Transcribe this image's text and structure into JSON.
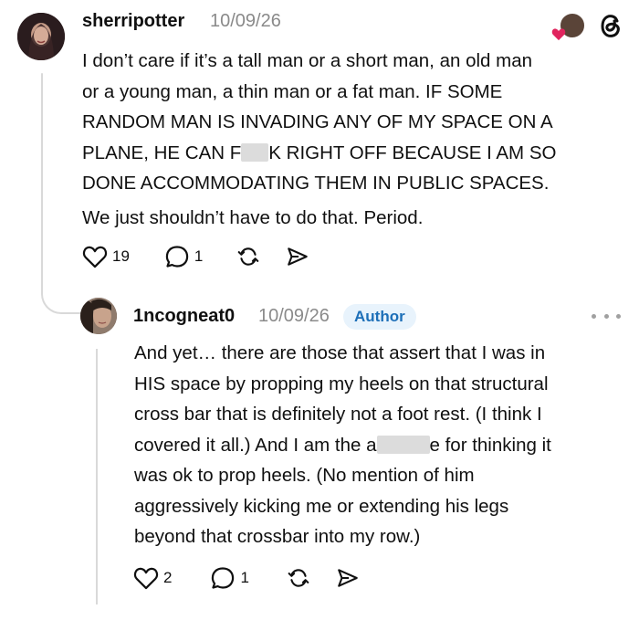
{
  "post": {
    "username": "sherripotter",
    "date": "10/09/26",
    "lines": [
      "I don’t care if it’s a tall man or a short man, an old man",
      "or a young man, a thin man or a fat man. IF SOME",
      "RANDOM MAN IS INVADING ANY OF MY SPACE ON A"
    ],
    "line4_before": "PLANE, HE CAN F",
    "line4_after": "K RIGHT OFF BECAUSE I AM SO",
    "lines_end": [
      "DONE ACCOMMODATING THEM IN PUBLIC SPACES.",
      "We just shouldn’t have to do that. Period."
    ],
    "likes": "19",
    "replies": "1"
  },
  "reply": {
    "username": "1ncogneat0",
    "date": "10/09/26",
    "badge": "Author",
    "lines": [
      "And yet… there are those that assert that I was in",
      "HIS space by propping my heels on that structural",
      "cross bar that is definitely not a foot rest. (I think I"
    ],
    "line4_before": "covered it all.) And I am the a",
    "line4_after": "e for thinking it",
    "lines_end": [
      "was ok to prop heels. (No mention of him",
      "aggressively kicking me or extending his legs",
      "beyond that crossbar into my row.)"
    ],
    "likes": "2",
    "replies": "1"
  },
  "icons": {
    "like": "heart-icon",
    "reply": "comment-icon",
    "repost": "repost-icon",
    "share": "share-icon",
    "app": "threads-logo-icon"
  },
  "colors": {
    "heart_red": "#e0245e",
    "badge_bg": "#e8f3fc",
    "badge_text": "#1d6fb8",
    "muted": "#8a8a8a"
  }
}
